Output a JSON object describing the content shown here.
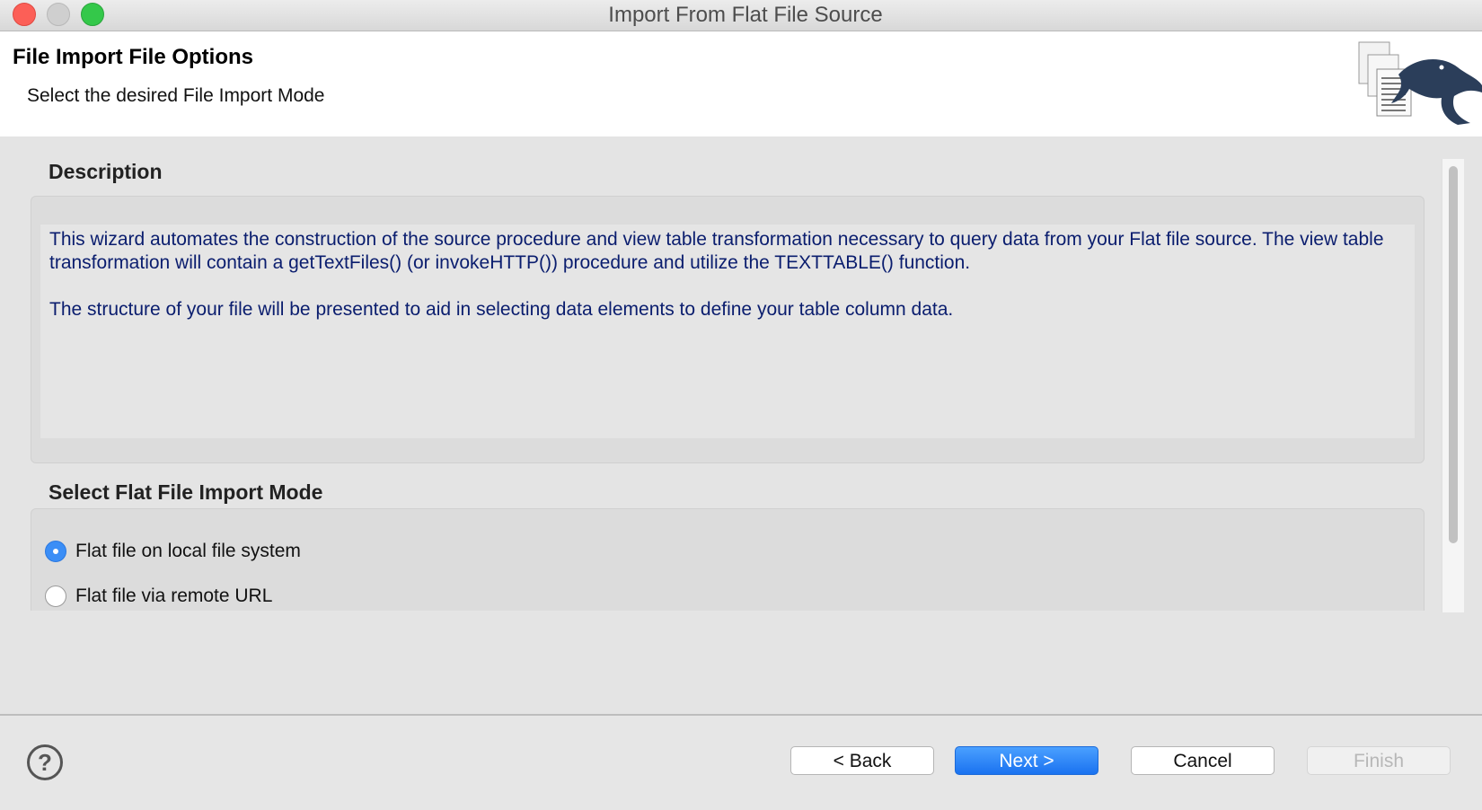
{
  "window": {
    "title": "Import From Flat File Source"
  },
  "header": {
    "title": "File Import File Options",
    "subtitle": "Select the desired File Import Mode",
    "logo_icon": "files-with-lizard-icon"
  },
  "description": {
    "label": "Description",
    "paragraph_1": "This wizard automates the construction of the source procedure and view table transformation necessary to query data from your Flat file source. The view table transformation will contain a getTextFiles() (or invokeHTTP()) procedure and utilize the TEXTTABLE() function.",
    "paragraph_2": "The structure of your file will be presented to aid in selecting data elements to define your table column data."
  },
  "import_mode": {
    "label": "Select Flat File Import Mode",
    "options": [
      {
        "label": "Flat file on local file system",
        "selected": true
      },
      {
        "label": "Flat file via remote URL",
        "selected": false
      }
    ]
  },
  "footer": {
    "help_icon": "question-mark-icon",
    "help_glyph": "?",
    "back_label": "< Back",
    "next_label": "Next >",
    "cancel_label": "Cancel",
    "finish_label": "Finish"
  },
  "colors": {
    "primary_button": "#1a72f0",
    "description_text": "#0a1d6e",
    "radio_selected": "#3b8ef6"
  }
}
